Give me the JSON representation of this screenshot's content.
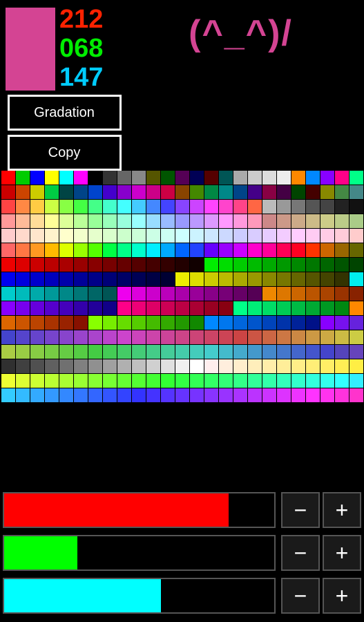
{
  "header": {
    "rgb": {
      "r": "212",
      "g": "068",
      "b": "147",
      "r_color": "#ff2200",
      "g_color": "#00ee00",
      "b_color": "#00ccff"
    },
    "swatch_color": "#d44493",
    "emoticon": "(^_^)/",
    "gradation_label": "Gradation",
    "copy_label": "Copy"
  },
  "sliders": [
    {
      "label": "red-slider",
      "color": "#ff0000",
      "fill_pct": 83
    },
    {
      "label": "green-slider",
      "color": "#00ff00",
      "fill_pct": 27
    },
    {
      "label": "blue-slider",
      "color": "#00ffff",
      "fill_pct": 58
    }
  ],
  "minus_label": "−",
  "plus_label": "+",
  "palette": {
    "colors": [
      "#ff0000",
      "#00cc00",
      "#0000ff",
      "#ffff00",
      "#00ffff",
      "#ff00ff",
      "#000000",
      "#333333",
      "#666666",
      "#888888",
      "#555500",
      "#005500",
      "#550055",
      "#000055",
      "#550000",
      "#005555",
      "#aaaaaa",
      "#cccccc",
      "#dddddd",
      "#eeeeee",
      "#ff8800",
      "#0088ff",
      "#8800ff",
      "#ff0088",
      "#00ff88",
      "#ffffff",
      "#cc0000",
      "#cc4400",
      "#cccc00",
      "#00cc44",
      "#004444",
      "#004488",
      "#0044cc",
      "#4400cc",
      "#8800cc",
      "#cc00cc",
      "#cc0088",
      "#cc0044",
      "#884400",
      "#448800",
      "#008844",
      "#008888",
      "#004488",
      "#440088",
      "#880044",
      "#440044",
      "#004400",
      "#440000",
      "#888800",
      "#448844",
      "#448888",
      "#444488",
      "#ff4444",
      "#ff8844",
      "#ffcc44",
      "#ccff44",
      "#88ff44",
      "#44ff44",
      "#44ff88",
      "#44ffcc",
      "#44ffff",
      "#44ccff",
      "#4488ff",
      "#4444ff",
      "#8844ff",
      "#cc44ff",
      "#ff44ff",
      "#ff44cc",
      "#ff4488",
      "#ff6644",
      "#bbbbbb",
      "#999999",
      "#777777",
      "#555555",
      "#444444",
      "#222222",
      "#111111",
      "#000000",
      "#ff9999",
      "#ffbb99",
      "#ffdd99",
      "#ffff99",
      "#ddff99",
      "#bbff99",
      "#99ff99",
      "#99ffbb",
      "#99ffdd",
      "#99ffff",
      "#99ddff",
      "#99bbff",
      "#9999ff",
      "#bb99ff",
      "#dd99ff",
      "#ff99ff",
      "#ff99dd",
      "#ff99bb",
      "#cc8888",
      "#cc9988",
      "#ccaa88",
      "#ccbb88",
      "#cccc88",
      "#bbcc88",
      "#aacc88",
      "#99cc88",
      "#ffcccc",
      "#ffd9cc",
      "#ffe6cc",
      "#fff3cc",
      "#ffffcc",
      "#f3ffcc",
      "#e6ffcc",
      "#d9ffcc",
      "#ccffcc",
      "#ccffd9",
      "#ccffe6",
      "#ccfff3",
      "#ccffff",
      "#ccf3ff",
      "#cce6ff",
      "#ccd9ff",
      "#ccccff",
      "#d9ccff",
      "#e6ccff",
      "#f3ccff",
      "#ffccff",
      "#ffccf3",
      "#ffcce6",
      "#ffccd9",
      "#ffcccc",
      "#ffffff",
      "#ff6666",
      "#ff7744",
      "#ff9922",
      "#ffbb00",
      "#ddff00",
      "#99ff00",
      "#55ff00",
      "#00ff44",
      "#00ff88",
      "#00ffcc",
      "#00eeff",
      "#00aaff",
      "#0066ff",
      "#2244ff",
      "#6600ff",
      "#9900ff",
      "#cc00ff",
      "#ff00cc",
      "#ff0099",
      "#ff0055",
      "#ff0022",
      "#ff3300",
      "#cc6600",
      "#996600",
      "#666600",
      "#336600",
      "#ee0000",
      "#dd0000",
      "#cc0000",
      "#bb0000",
      "#aa0000",
      "#990000",
      "#880000",
      "#770000",
      "#660000",
      "#550000",
      "#440000",
      "#330000",
      "#220000",
      "#110000",
      "#00ee00",
      "#00dd00",
      "#00cc00",
      "#00bb00",
      "#00aa00",
      "#009900",
      "#008800",
      "#007700",
      "#006600",
      "#005500",
      "#004400",
      "#003300",
      "#0000ee",
      "#0000dd",
      "#0000cc",
      "#0000bb",
      "#0000aa",
      "#000099",
      "#000088",
      "#000077",
      "#000066",
      "#000055",
      "#000044",
      "#000033",
      "#eeee00",
      "#dddd00",
      "#cccc00",
      "#bbbb00",
      "#aaaa00",
      "#999900",
      "#888800",
      "#777700",
      "#666600",
      "#555500",
      "#444400",
      "#333300",
      "#00eeee",
      "#00dddd",
      "#00cccc",
      "#00bbbb",
      "#00aaaa",
      "#009999",
      "#008888",
      "#007777",
      "#006666",
      "#005555",
      "#ee00ee",
      "#dd00dd",
      "#cc00cc",
      "#bb00bb",
      "#aa00aa",
      "#990099",
      "#880088",
      "#770077",
      "#660066",
      "#550055",
      "#ee8800",
      "#dd7700",
      "#cc6600",
      "#bb5500",
      "#aa4400",
      "#993300",
      "#882200",
      "#771100",
      "#8800ff",
      "#7700ee",
      "#6600dd",
      "#5500cc",
      "#4400bb",
      "#3300aa",
      "#220099",
      "#110088",
      "#ff0088",
      "#ee0077",
      "#dd0066",
      "#cc0055",
      "#bb0044",
      "#aa0033",
      "#990022",
      "#880011",
      "#00ff88",
      "#00ee77",
      "#00dd66",
      "#00cc55",
      "#00bb44",
      "#00aa33",
      "#009922",
      "#008811",
      "#ff8800",
      "#ee7700",
      "#dd6600",
      "#cc5500",
      "#bb4400",
      "#aa3300",
      "#992200",
      "#881100",
      "#88ff00",
      "#77ee00",
      "#66dd00",
      "#55cc00",
      "#44bb00",
      "#33aa00",
      "#229900",
      "#118800",
      "#0088ff",
      "#0077ee",
      "#0066dd",
      "#0055cc",
      "#0044bb",
      "#0033aa",
      "#002299",
      "#001188",
      "#8800ff",
      "#7711ee",
      "#6622dd",
      "#5533cc",
      "#4444cc",
      "#5544cc",
      "#6644cc",
      "#7744cc",
      "#8844cc",
      "#9944cc",
      "#aa44cc",
      "#bb44cc",
      "#cc44cc",
      "#cc44bb",
      "#cc44aa",
      "#cc4499",
      "#cc4488",
      "#cc4477",
      "#cc4466",
      "#cc4455",
      "#cc4444",
      "#cc5544",
      "#cc6644",
      "#cc7744",
      "#cc8844",
      "#cc9944",
      "#ccaa44",
      "#ccbb44",
      "#cccc44",
      "#bbcc44",
      "#aacc44",
      "#99cc44",
      "#88cc44",
      "#77cc44",
      "#66cc44",
      "#55cc44",
      "#44cc44",
      "#44cc55",
      "#44cc66",
      "#44cc77",
      "#44cc88",
      "#44cc99",
      "#44ccaa",
      "#44ccbb",
      "#44cccc",
      "#44bbcc",
      "#44aacc",
      "#4499cc",
      "#4488cc",
      "#4477cc",
      "#4466cc",
      "#4455cc",
      "#4444cc",
      "#5544bb",
      "#6644bb",
      "#7744bb",
      "#303030",
      "#404040",
      "#505050",
      "#606060",
      "#707070",
      "#808080",
      "#909090",
      "#a0a0a0",
      "#b0b0b0",
      "#c0c0c0",
      "#d0d0d0",
      "#e0e0e0",
      "#f0f0f0",
      "#ffffff",
      "#ffeeee",
      "#ffeedd",
      "#ffeecc",
      "#ffeebb",
      "#ffeeaa",
      "#ffee99",
      "#ffee88",
      "#ffee77",
      "#ffee66",
      "#ffee55",
      "#ffee44",
      "#ffee33",
      "#eeff33",
      "#ddff33",
      "#ccff33",
      "#bbff33",
      "#aaff33",
      "#99ff33",
      "#88ff33",
      "#77ff33",
      "#66ff33",
      "#55ff33",
      "#44ff33",
      "#33ff33",
      "#33ff44",
      "#33ff55",
      "#33ff66",
      "#33ff77",
      "#33ff88",
      "#33ff99",
      "#33ffaa",
      "#33ffbb",
      "#33ffcc",
      "#33ffdd",
      "#33ffee",
      "#33ffff",
      "#33eeff",
      "#33ddff",
      "#33ccff",
      "#33bbff",
      "#33aaff",
      "#3399ff",
      "#3388ff",
      "#3377ff",
      "#3366ff",
      "#3355ff",
      "#3344ff",
      "#3333ff",
      "#4433ff",
      "#5533ff",
      "#6633ff",
      "#7733ff",
      "#8833ff",
      "#9933ff",
      "#aa33ff",
      "#bb33ff",
      "#cc33ff",
      "#dd33ff",
      "#ee33ff",
      "#ff33ff",
      "#ff33ee",
      "#ff33dd",
      "#ff33cc",
      "#ff33bb"
    ]
  }
}
